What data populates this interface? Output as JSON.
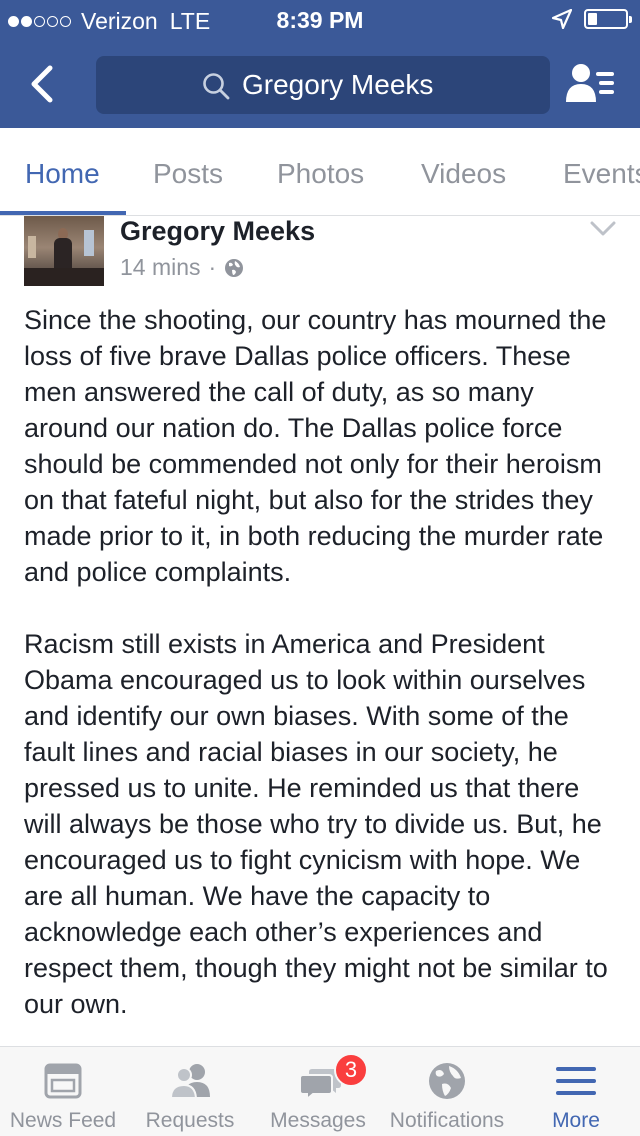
{
  "status_bar": {
    "carrier": "Verizon",
    "network": "LTE",
    "time": "8:39 PM",
    "signal_bars_filled": 2,
    "signal_bars_total": 5,
    "battery_level": 0.25,
    "location_icon": "location-arrow-icon"
  },
  "nav": {
    "back_icon": "back-chevron-icon",
    "search_icon": "search-icon",
    "search_text": "Gregory Meeks",
    "profile_icon": "profile-list-icon"
  },
  "tabs": [
    {
      "label": "Home",
      "active": true
    },
    {
      "label": "Posts",
      "active": false
    },
    {
      "label": "Photos",
      "active": false
    },
    {
      "label": "Videos",
      "active": false
    },
    {
      "label": "Events",
      "active": false
    }
  ],
  "post": {
    "author": "Gregory Meeks",
    "timestamp": "14 mins",
    "separator": "·",
    "privacy_icon": "globe-icon",
    "paragraphs": [
      "Since the shooting, our country has mourned the loss of five brave Dallas police officers. These men answered the call of duty, as so many around our nation do. The Dallas police force should be commended not only for their heroism on that fateful night, but also for the strides they made prior to it, in both reducing the murder rate and police complaints.",
      "Racism still exists in America and President Obama encouraged us to look within ourselves and identify our own biases. With some of the fault lines and racial biases in our society, he pressed us to unite. He reminded us that there will always be those who try to divide us. But, he encouraged us to fight cynicism with hope. We are all human. We have the capacity to acknowledge each other’s experiences and respect them, though they might not be similar to our own."
    ]
  },
  "bottom_tabs": [
    {
      "label": "News Feed",
      "icon": "news-feed-icon",
      "active": false
    },
    {
      "label": "Requests",
      "icon": "friend-requests-icon",
      "active": false
    },
    {
      "label": "Messages",
      "icon": "messages-icon",
      "active": false,
      "badge": "3"
    },
    {
      "label": "Notifications",
      "icon": "globe-icon",
      "active": false
    },
    {
      "label": "More",
      "icon": "hamburger-menu-icon",
      "active": true
    }
  ],
  "colors": {
    "brand": "#3b5998",
    "search_bg": "#2c4579",
    "active_tab": "#4267b2",
    "inactive_text": "#90949c",
    "badge": "#fa3e3e"
  }
}
